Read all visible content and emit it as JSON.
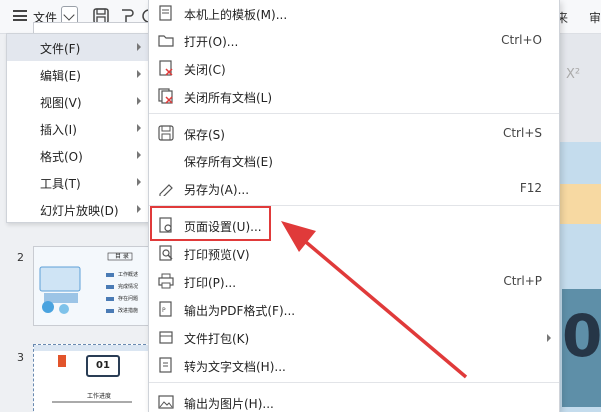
{
  "toolbar": {
    "file_label": "文件",
    "right_labels": [
      "来",
      "审"
    ]
  },
  "thumbnails": [
    {
      "number": "2",
      "title": "目 录",
      "lines": [
        "工作概述",
        "完成情况",
        "存在问题",
        "改进措施"
      ]
    },
    {
      "number": "3",
      "badge": "01",
      "caption": "工作进度"
    }
  ],
  "left_menu": {
    "items": [
      {
        "label": "文件(F)",
        "active": true
      },
      {
        "label": "编辑(E)"
      },
      {
        "label": "视图(V)"
      },
      {
        "label": "插入(I)"
      },
      {
        "label": "格式(O)"
      },
      {
        "label": "工具(T)"
      },
      {
        "label": "幻灯片放映(D)"
      }
    ]
  },
  "file_menu": {
    "items": [
      {
        "label": "本机上的模板(M)...",
        "shortcut": "",
        "icon": "template-icon"
      },
      {
        "label": "打开(O)...",
        "shortcut": "Ctrl+O",
        "icon": "folder-open-icon"
      },
      {
        "label": "关闭(C)",
        "shortcut": "",
        "icon": "close-doc-icon"
      },
      {
        "label": "关闭所有文档(L)",
        "shortcut": "",
        "icon": "close-all-icon"
      },
      {
        "label": "保存(S)",
        "shortcut": "Ctrl+S",
        "icon": "save-icon"
      },
      {
        "label": "保存所有文档(E)",
        "shortcut": "",
        "icon": ""
      },
      {
        "label": "另存为(A)...",
        "shortcut": "F12",
        "icon": "save-as-icon"
      },
      {
        "label": "页面设置(U)...",
        "shortcut": "",
        "icon": "page-setup-icon"
      },
      {
        "label": "打印预览(V)",
        "shortcut": "",
        "icon": "print-preview-icon"
      },
      {
        "label": "打印(P)...",
        "shortcut": "Ctrl+P",
        "icon": "print-icon"
      },
      {
        "label": "输出为PDF格式(F)...",
        "shortcut": "",
        "icon": "pdf-icon"
      },
      {
        "label": "文件打包(K)",
        "shortcut": "",
        "icon": "package-icon"
      },
      {
        "label": "转为文字文档(H)...",
        "shortcut": "",
        "icon": "convert-doc-icon"
      },
      {
        "label": "输出为图片(H)...",
        "shortcut": "",
        "icon": "image-icon"
      }
    ]
  },
  "colors": {
    "highlight": "#e03a3a",
    "accent_blue": "#3a7bd5"
  }
}
